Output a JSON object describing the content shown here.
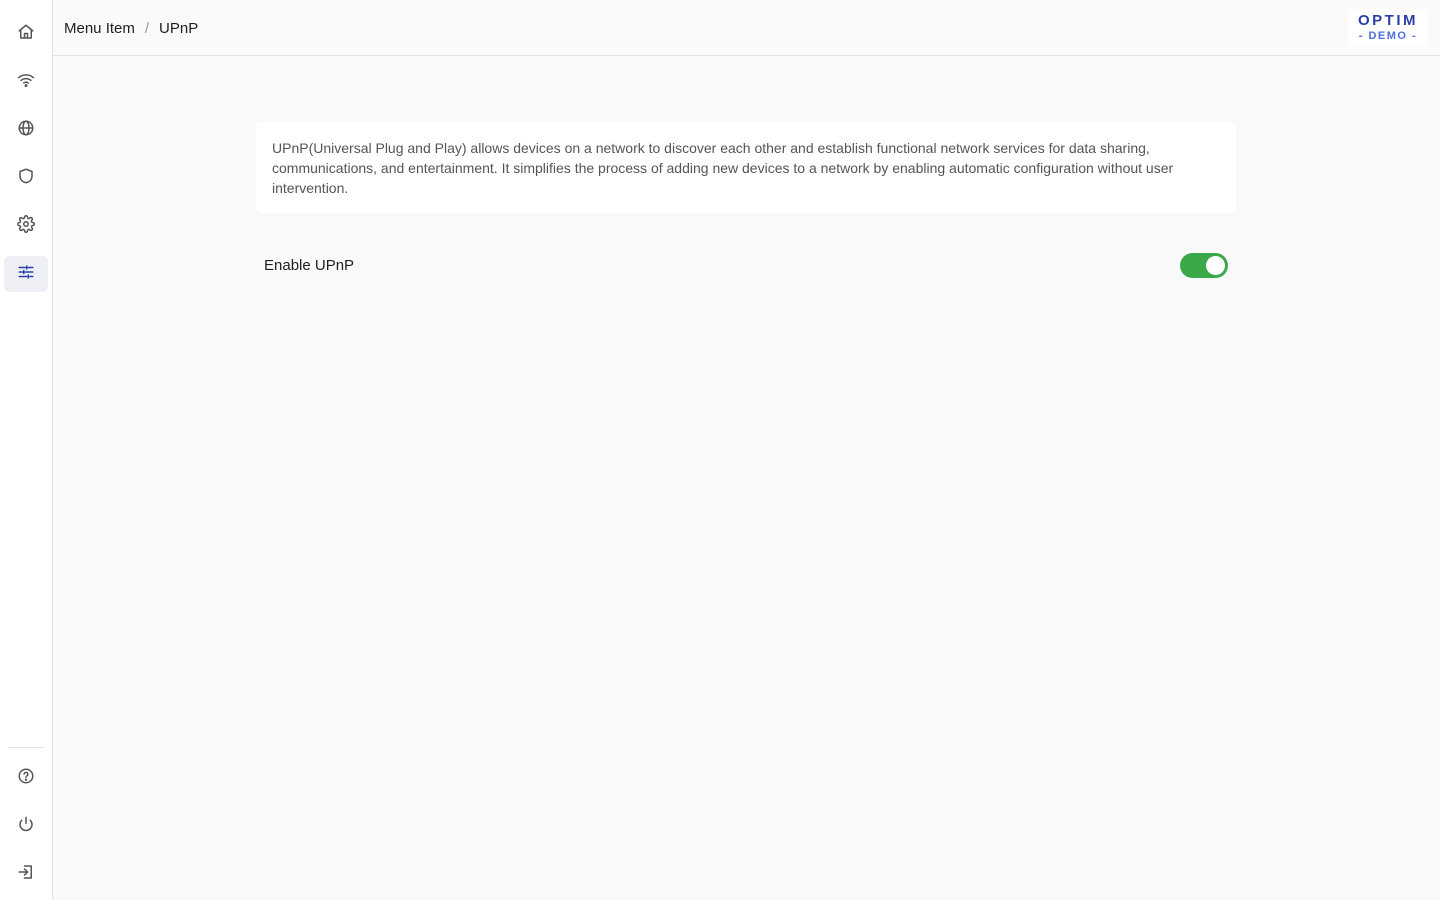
{
  "sidebar": {
    "items": [
      {
        "icon": "home-icon",
        "name": "sidebar-item-home",
        "active": false
      },
      {
        "icon": "wifi-icon",
        "name": "sidebar-item-wifi",
        "active": false
      },
      {
        "icon": "globe-icon",
        "name": "sidebar-item-internet",
        "active": false
      },
      {
        "icon": "shield-icon",
        "name": "sidebar-item-security",
        "active": false
      },
      {
        "icon": "gear-icon",
        "name": "sidebar-item-settings",
        "active": false
      },
      {
        "icon": "sliders-icon",
        "name": "sidebar-item-advanced",
        "active": true
      }
    ],
    "bottom_items": [
      {
        "icon": "help-circle-icon",
        "name": "sidebar-item-help"
      },
      {
        "icon": "power-icon",
        "name": "sidebar-item-power"
      },
      {
        "icon": "logout-icon",
        "name": "sidebar-item-logout"
      }
    ],
    "active_color": "#2b3fa6",
    "icon_color": "#555555"
  },
  "header": {
    "breadcrumb": [
      "Menu Item",
      "UPnP"
    ],
    "separator": "/",
    "logo": {
      "top": "OPTIM",
      "bottom": "- DEMO -"
    }
  },
  "main": {
    "description": "UPnP(Universal Plug and Play) allows devices on a network to discover each other and establish functional network services for data sharing, communications, and entertainment. It simplifies the process of adding new devices to a network by enabling automatic configuration without user intervention.",
    "setting": {
      "label": "Enable UPnP",
      "enabled": true,
      "toggle_color": "#3da84a"
    }
  }
}
